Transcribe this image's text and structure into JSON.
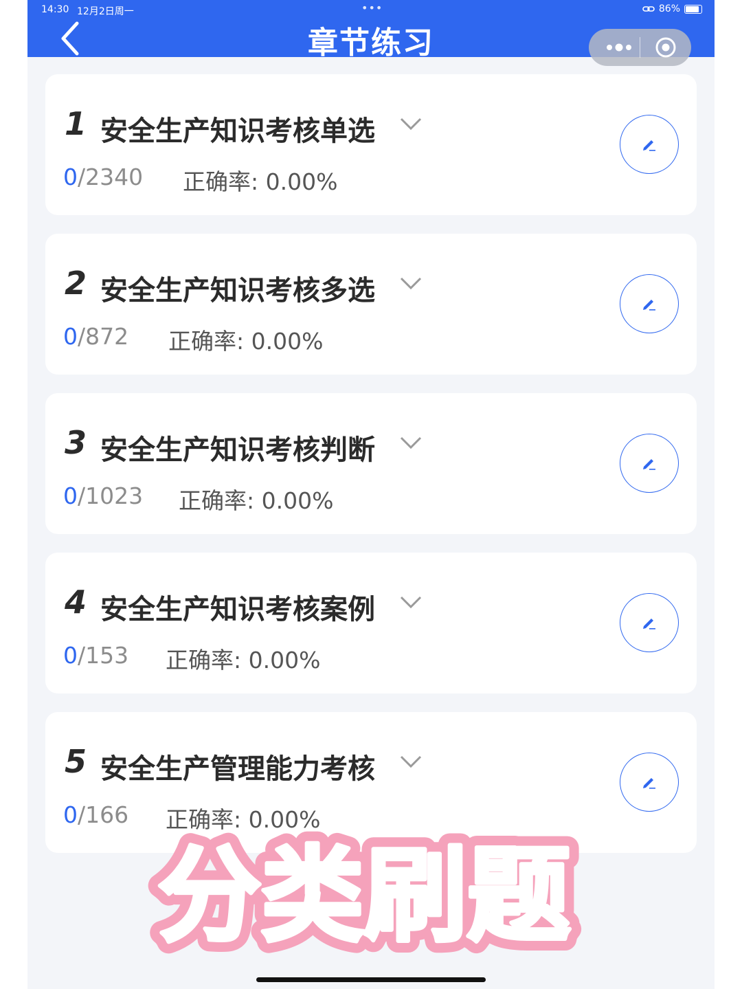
{
  "status_bar": {
    "time": "14:30",
    "date": "12月2日周一",
    "battery": "86%"
  },
  "navbar": {
    "title": "章节练习"
  },
  "chapters": [
    {
      "num": "1",
      "title": "安全生产知识考核单选",
      "done": "0",
      "total": "/2340",
      "accuracy": "正确率: 0.00%"
    },
    {
      "num": "2",
      "title": "安全生产知识考核多选",
      "done": "0",
      "total": "/872",
      "accuracy": "正确率: 0.00%"
    },
    {
      "num": "3",
      "title": "安全生产知识考核判断",
      "done": "0",
      "total": "/1023",
      "accuracy": "正确率: 0.00%"
    },
    {
      "num": "4",
      "title": "安全生产知识考核案例",
      "done": "0",
      "total": "/153",
      "accuracy": "正确率: 0.00%"
    },
    {
      "num": "5",
      "title": "安全生产管理能力考核",
      "done": "0",
      "total": "/166",
      "accuracy": "正确率: 0.00%"
    }
  ],
  "overlay_text": "分类刷题",
  "colors": {
    "primary": "#2f67ef",
    "background": "#f3f5f9",
    "overlay_fill": "#f5a2bb"
  }
}
